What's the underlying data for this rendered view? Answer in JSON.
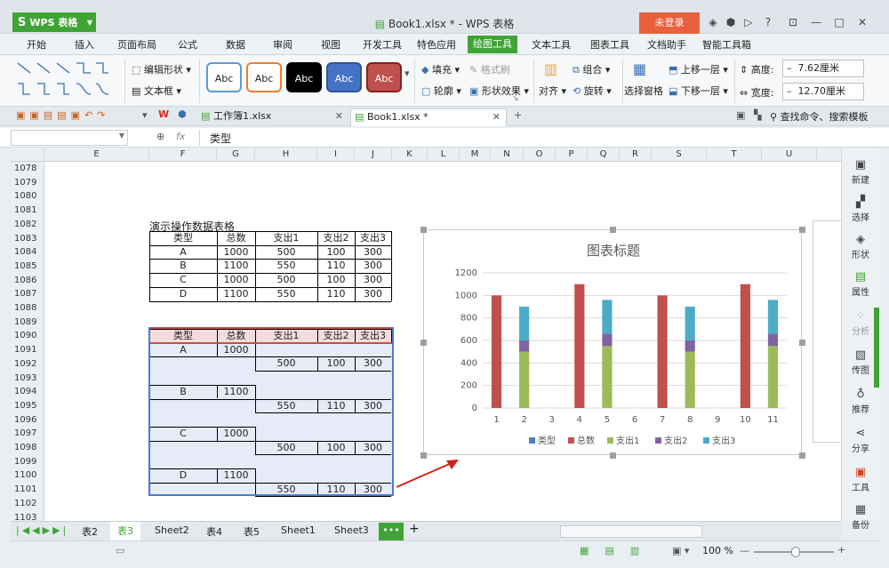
{
  "app": {
    "logo_label": "WPS 表格",
    "window_title": "Book1.xlsx * - WPS 表格",
    "login_label": "未登录"
  },
  "menu": {
    "tabs": [
      "开始",
      "插入",
      "页面布局",
      "公式",
      "数据",
      "审阅",
      "视图",
      "开发工具",
      "特色应用",
      "绘图工具",
      "文本工具",
      "图表工具",
      "文档助手",
      "智能工具箱"
    ],
    "active": "绘图工具"
  },
  "ribbon": {
    "edit_shape": "编辑形状",
    "textbox": "文本框",
    "style_samples": [
      "Abc",
      "Abc",
      "Abc",
      "Abc",
      "Abc"
    ],
    "fill": "填充",
    "format_painter": "格式刷",
    "outline": "轮廓",
    "shape_effect": "形状效果",
    "align": "对齐",
    "group": "组合",
    "rotate": "旋转",
    "selection_pane": "选择窗格",
    "bring_forward": "上移一层",
    "send_backward": "下移一层",
    "height_label": "高度:",
    "height_value": "7.62厘米",
    "width_label": "宽度:",
    "width_value": "12.70厘米"
  },
  "doc_tabs": [
    {
      "name": "工作簿1.xlsx",
      "active": false
    },
    {
      "name": "Book1.xlsx *",
      "active": true
    }
  ],
  "search_placeholder": "查找命令、搜索模板",
  "formula": {
    "fx": "fx",
    "content": "类型"
  },
  "columns": [
    "E",
    "F",
    "G",
    "H",
    "I",
    "J",
    "K",
    "L",
    "M",
    "N",
    "O",
    "P",
    "Q",
    "R",
    "S",
    "T",
    "U"
  ],
  "rows": [
    "1078",
    "1079",
    "1080",
    "1081",
    "1082",
    "1083",
    "1084",
    "1085",
    "1086",
    "1087",
    "1088",
    "1089",
    "1090",
    "1091",
    "1092",
    "1093",
    "1094",
    "1095",
    "1096",
    "1097",
    "1098",
    "1099",
    "1100",
    "1101",
    "1102",
    "1103"
  ],
  "table1": {
    "title": "演示操作数据表格",
    "headers": [
      "类型",
      "总数",
      "支出1",
      "支出2",
      "支出3"
    ],
    "rows": [
      [
        "A",
        "1000",
        "500",
        "100",
        "300"
      ],
      [
        "B",
        "1100",
        "550",
        "110",
        "300"
      ],
      [
        "C",
        "1000",
        "500",
        "100",
        "300"
      ],
      [
        "D",
        "1100",
        "550",
        "110",
        "300"
      ]
    ]
  },
  "table2": {
    "headers": [
      "类型",
      "总数",
      "支出1",
      "支出2",
      "支出3"
    ],
    "groups": [
      {
        "type": "A",
        "total": "1000",
        "e1": "500",
        "e2": "100",
        "e3": "300"
      },
      {
        "type": "B",
        "total": "1100",
        "e1": "550",
        "e2": "110",
        "e3": "300"
      },
      {
        "type": "C",
        "total": "1000",
        "e1": "500",
        "e2": "100",
        "e3": "300"
      },
      {
        "type": "D",
        "total": "1100",
        "e1": "550",
        "e2": "110",
        "e3": "300"
      }
    ]
  },
  "chart_data": {
    "type": "bar",
    "stacked": true,
    "title": "图表标题",
    "categories": [
      "1",
      "2",
      "3",
      "4",
      "5",
      "6",
      "7",
      "8",
      "9",
      "10",
      "11"
    ],
    "ylim": [
      0,
      1200
    ],
    "yticks": [
      0,
      200,
      400,
      600,
      800,
      1000,
      1200
    ],
    "grid": true,
    "legend_position": "bottom",
    "series": [
      {
        "name": "类型",
        "color": "#4f81bd",
        "values": [
          0,
          0,
          0,
          0,
          0,
          0,
          0,
          0,
          0,
          0,
          0
        ]
      },
      {
        "name": "总数",
        "color": "#c0504d",
        "values": [
          1000,
          0,
          0,
          1100,
          0,
          0,
          1000,
          0,
          0,
          1100,
          0
        ]
      },
      {
        "name": "支出1",
        "color": "#9bbb59",
        "values": [
          0,
          500,
          0,
          0,
          550,
          0,
          0,
          500,
          0,
          0,
          550
        ]
      },
      {
        "name": "支出2",
        "color": "#8064a2",
        "values": [
          0,
          100,
          0,
          0,
          110,
          0,
          0,
          100,
          0,
          0,
          110
        ]
      },
      {
        "name": "支出3",
        "color": "#4bacc6",
        "values": [
          0,
          300,
          0,
          0,
          300,
          0,
          0,
          300,
          0,
          0,
          300
        ]
      }
    ]
  },
  "right_panel": [
    "新建",
    "选择",
    "形状",
    "属性",
    "分析",
    "传图",
    "推荐",
    "分享",
    "工具",
    "备份"
  ],
  "sheet_tabs": [
    "表2",
    "表3",
    "Sheet2",
    "表4",
    "表5",
    "Sheet1",
    "Sheet3"
  ],
  "active_sheet": "表3",
  "zoom": "100 %",
  "colors": {
    "brand": "#3fa435",
    "login": "#e8603c",
    "selection": "#c0504d",
    "range": "#e6ebf7"
  }
}
